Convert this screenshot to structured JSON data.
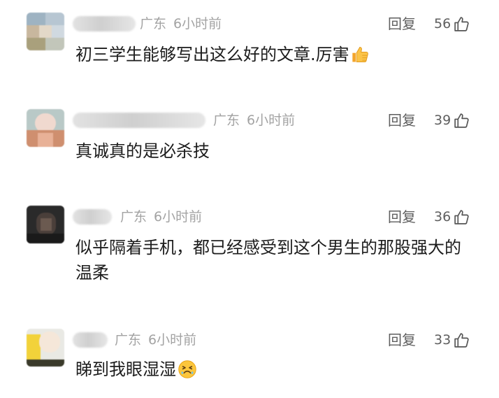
{
  "comments": [
    {
      "location": "广东",
      "time": "6小时前",
      "reply_label": "回复",
      "likes": "56",
      "text": "初三学生能够写出这么好的文章.厉害",
      "emoji": "thumbs-up-emoji"
    },
    {
      "location": "广东",
      "time": "6小时前",
      "reply_label": "回复",
      "likes": "39",
      "text": "真诚真的是必杀技"
    },
    {
      "location": "广东",
      "time": "6小时前",
      "reply_label": "回复",
      "likes": "36",
      "text": "似乎隔着手机，都已经感受到这个男生的那股强大的温柔"
    },
    {
      "location": "广东",
      "time": "6小时前",
      "reply_label": "回复",
      "likes": "33",
      "text": "睇到我眼湿湿",
      "emoji": "persevering-face-emoji"
    }
  ],
  "icons": {
    "like": "thumbs-up-outline-icon"
  },
  "colors": {
    "meta_text": "#a3a3a3",
    "action_text": "#5e5e5e",
    "body_text": "#1c1c1c"
  }
}
